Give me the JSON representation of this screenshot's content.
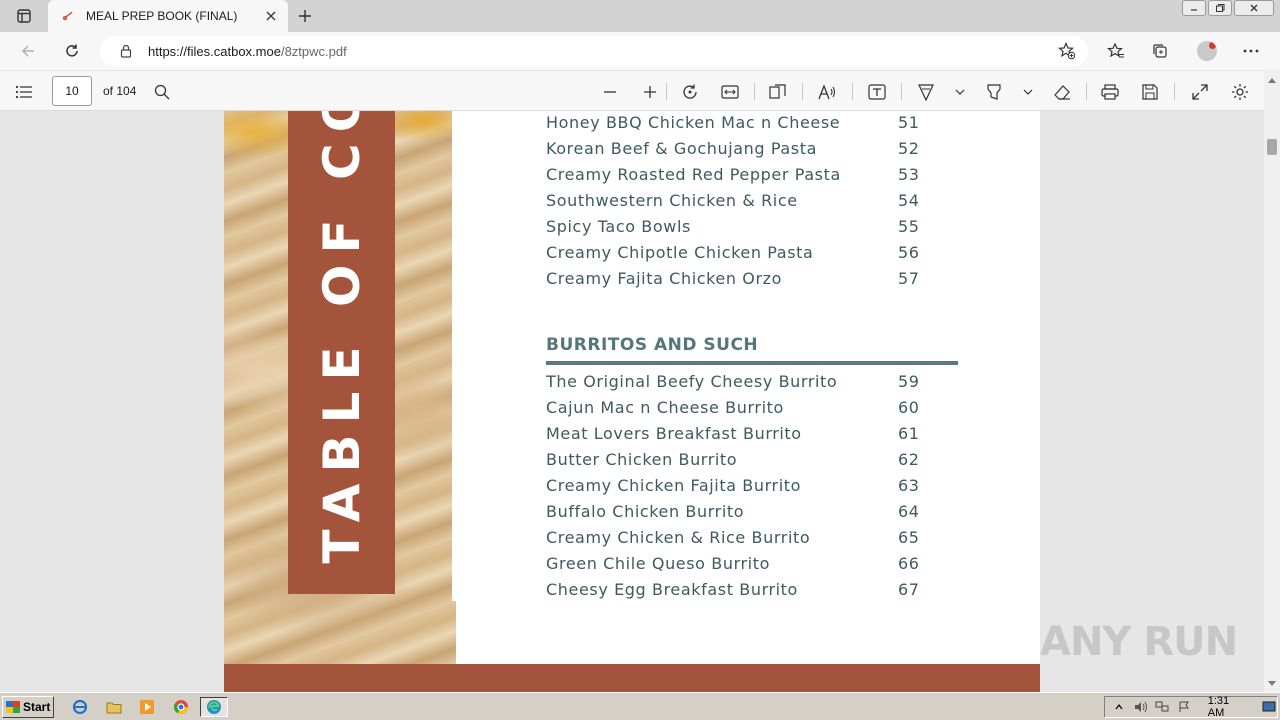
{
  "browser": {
    "tab_title": "MEAL PREP BOOK (FINAL)",
    "url_host": "https://files.catbox.moe",
    "url_path": "/8ztpwc.pdf"
  },
  "pdf_toolbar": {
    "page_number": "10",
    "page_count": "of 104"
  },
  "page": {
    "spine_text": "TABLE OF CON",
    "pasta_items": [
      {
        "name": "Honey BBQ Chicken Mac n Cheese",
        "page": "51"
      },
      {
        "name": "Korean Beef & Gochujang Pasta",
        "page": "52"
      },
      {
        "name": "Creamy Roasted Red Pepper Pasta",
        "page": "53"
      },
      {
        "name": "Southwestern Chicken & Rice",
        "page": "54"
      },
      {
        "name": "Spicy Taco Bowls",
        "page": "55"
      },
      {
        "name": "Creamy Chipotle Chicken Pasta",
        "page": "56"
      },
      {
        "name": "Creamy Fajita Chicken Orzo",
        "page": "57"
      }
    ],
    "section_title": "BURRITOS AND SUCH",
    "burrito_items": [
      {
        "name": "The Original Beefy Cheesy Burrito",
        "page": "59"
      },
      {
        "name": "Cajun Mac n Cheese Burrito",
        "page": "60"
      },
      {
        "name": "Meat Lovers Breakfast Burrito",
        "page": "61"
      },
      {
        "name": "Butter Chicken Burrito",
        "page": "62"
      },
      {
        "name": "Creamy Chicken Fajita Burrito",
        "page": "63"
      },
      {
        "name": "Buffalo Chicken Burrito",
        "page": "64"
      },
      {
        "name": "Creamy Chicken & Rice Burrito",
        "page": "65"
      },
      {
        "name": "Green Chile Queso Burrito",
        "page": "66"
      },
      {
        "name": "Cheesy Egg Breakfast Burrito",
        "page": "67"
      }
    ],
    "accent_color": "#a4543a",
    "text_color": "#3e5a60"
  },
  "watermark": "ANY RUN",
  "taskbar": {
    "start_label": "Start",
    "clock": "1:31 AM"
  }
}
